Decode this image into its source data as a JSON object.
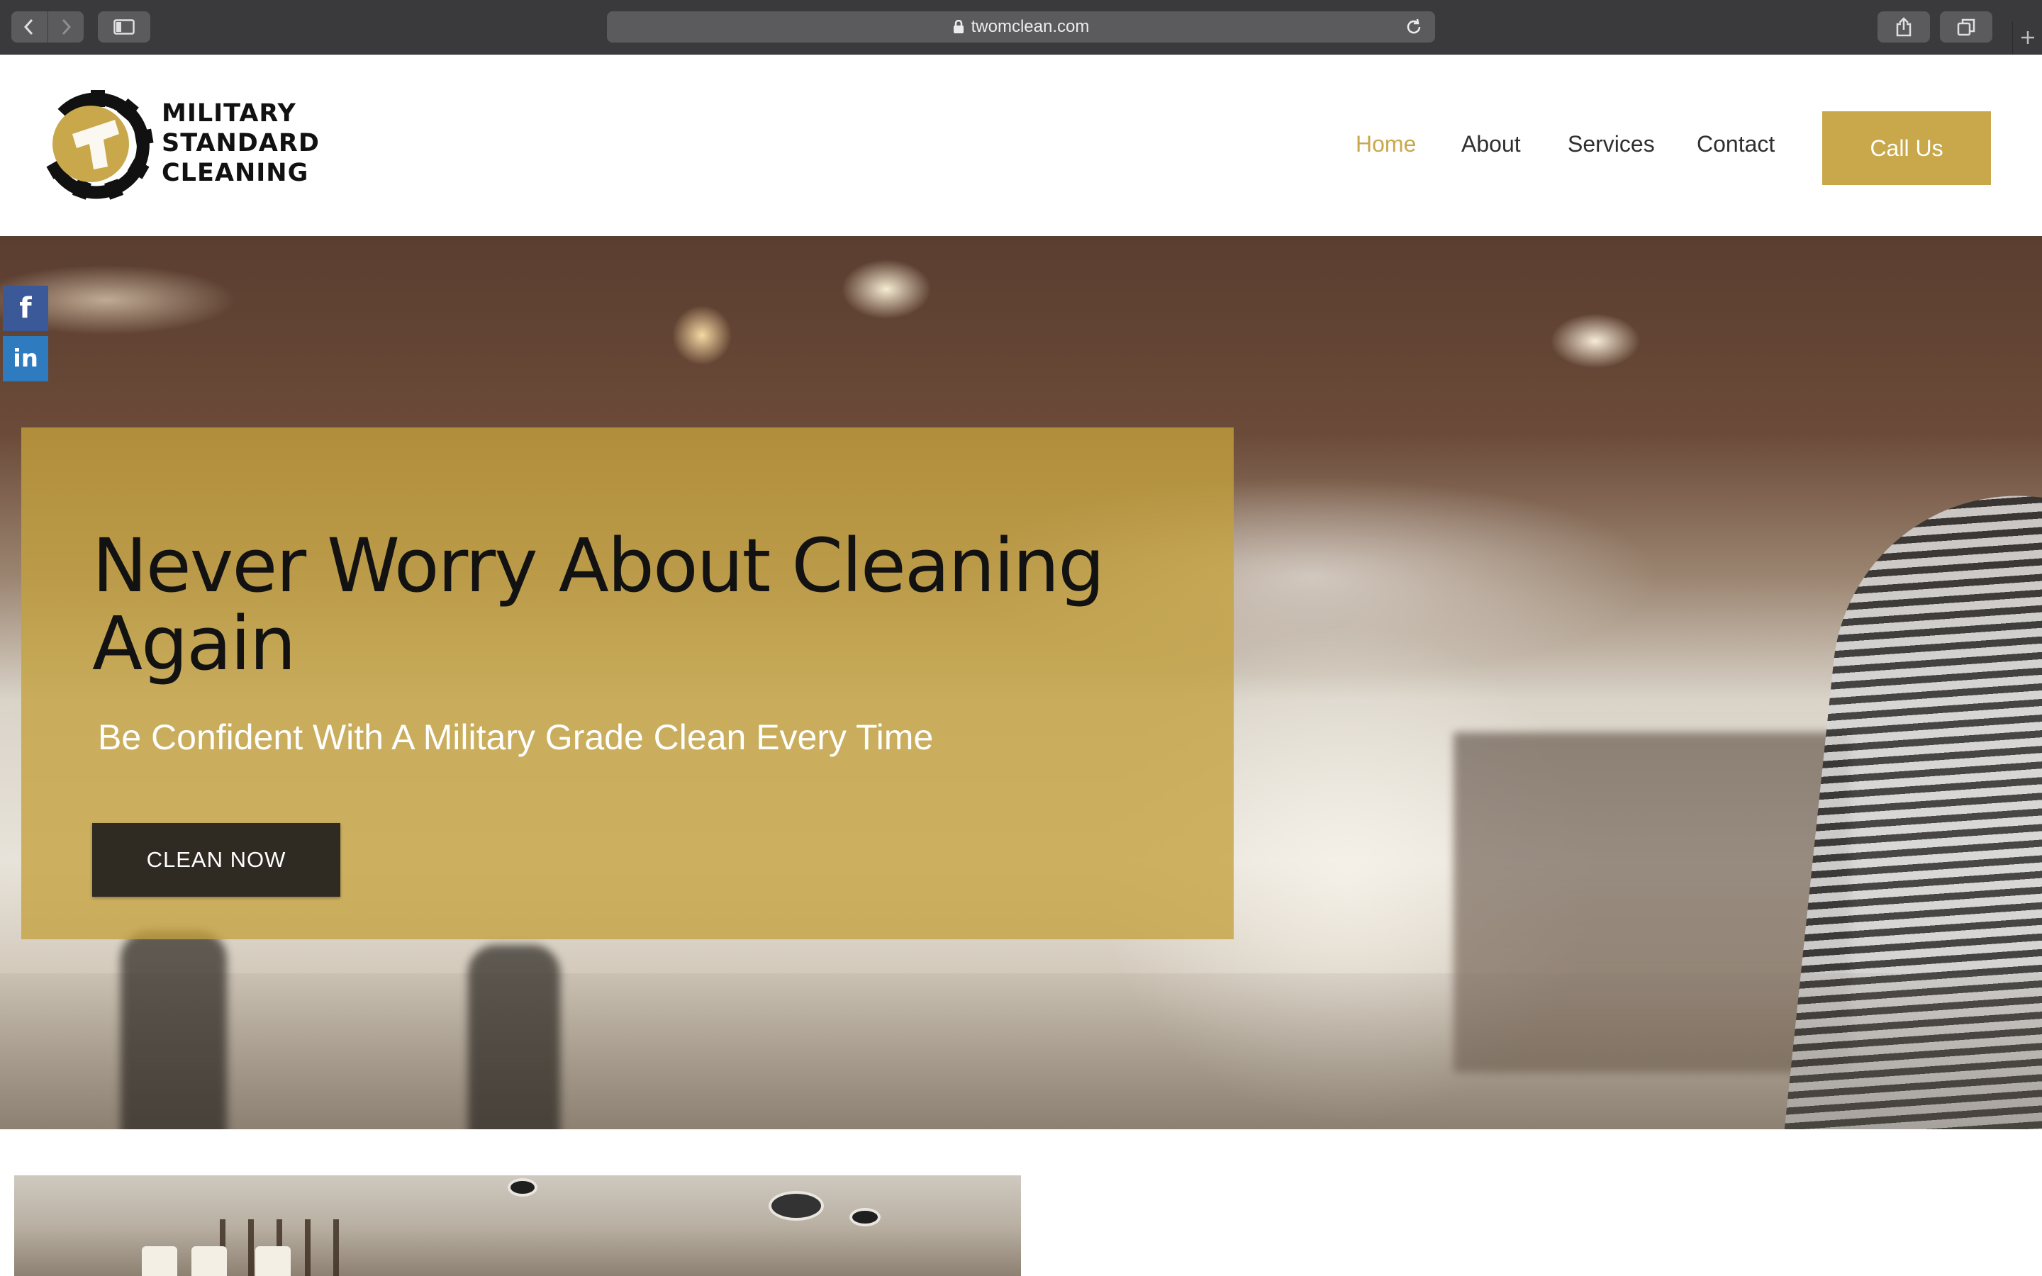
{
  "browser": {
    "url": "twomclean.com"
  },
  "header": {
    "logo_lines": [
      "MILITARY",
      "STANDARD",
      "CLEANING"
    ],
    "nav": [
      {
        "label": "Home",
        "active": true
      },
      {
        "label": "About",
        "active": false
      },
      {
        "label": "Services",
        "active": false
      },
      {
        "label": "Contact",
        "active": false
      }
    ],
    "cta_label": "Call Us"
  },
  "social": {
    "facebook_glyph": "f",
    "linkedin_glyph": "in"
  },
  "hero": {
    "title": "Never Worry About Cleaning Again",
    "subtitle": "Be Confident With A Military Grade Clean Every Time",
    "button_label": "CLEAN NOW"
  },
  "colors": {
    "brand_gold": "#c9a84b",
    "nav_text": "#2f2f2f",
    "button_dark": "#2f2b23",
    "facebook": "#3b5998",
    "linkedin": "#2f7bbf"
  },
  "icons": [
    "back-icon",
    "forward-icon",
    "sidebar-icon",
    "lock-icon",
    "reload-icon",
    "share-icon",
    "tabs-icon",
    "plus-icon",
    "facebook-icon",
    "linkedin-icon",
    "gear-logo-icon"
  ]
}
